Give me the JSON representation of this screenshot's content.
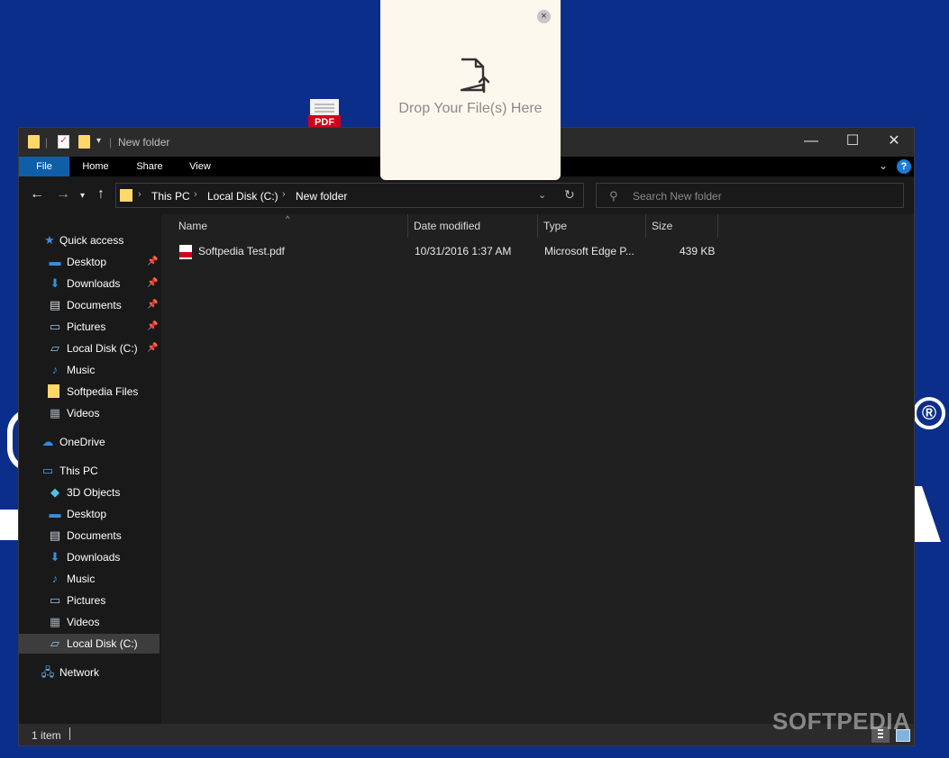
{
  "desktop": {
    "pdf_icon_label": "PDF",
    "registered_mark": "®"
  },
  "drop_panel": {
    "text": "Drop Your File(s) Here",
    "close_glyph": "×"
  },
  "window": {
    "title": "New folder",
    "dropdown_glyph": "▾",
    "controls": {
      "minimize": "—",
      "maximize": "☐",
      "close": "✕"
    }
  },
  "menu": {
    "file": "File",
    "home": "Home",
    "share": "Share",
    "view": "View",
    "help": "?"
  },
  "address": {
    "crumbs": [
      "This PC",
      "Local Disk (C:)",
      "New folder"
    ],
    "search_placeholder": "Search New folder"
  },
  "nav": {
    "quick_access": "Quick access",
    "quick_items": [
      {
        "label": "Desktop",
        "icon": "desktop-icon",
        "pinned": true
      },
      {
        "label": "Downloads",
        "icon": "downloads-icon",
        "pinned": true
      },
      {
        "label": "Documents",
        "icon": "documents-icon",
        "pinned": true
      },
      {
        "label": "Pictures",
        "icon": "pictures-icon",
        "pinned": true
      },
      {
        "label": "Local Disk (C:)",
        "icon": "local-disk-icon",
        "pinned": true
      },
      {
        "label": "Music",
        "icon": "music-icon",
        "pinned": false
      },
      {
        "label": "Softpedia Files",
        "icon": "folder-icon",
        "pinned": false
      },
      {
        "label": "Videos",
        "icon": "videos-icon",
        "pinned": false
      }
    ],
    "onedrive": "OneDrive",
    "this_pc": "This PC",
    "pc_items": [
      {
        "label": "3D Objects",
        "icon": "3d-objects-icon"
      },
      {
        "label": "Desktop",
        "icon": "desktop-icon"
      },
      {
        "label": "Documents",
        "icon": "documents-icon"
      },
      {
        "label": "Downloads",
        "icon": "downloads-icon"
      },
      {
        "label": "Music",
        "icon": "music-icon"
      },
      {
        "label": "Pictures",
        "icon": "pictures-icon"
      },
      {
        "label": "Videos",
        "icon": "videos-icon"
      },
      {
        "label": "Local Disk (C:)",
        "icon": "local-disk-icon",
        "selected": true
      }
    ],
    "network": "Network"
  },
  "columns": {
    "name": "Name",
    "date_modified": "Date modified",
    "type": "Type",
    "size": "Size"
  },
  "files": [
    {
      "name": "Softpedia Test.pdf",
      "date_modified": "10/31/2016 1:37 AM",
      "type": "Microsoft Edge P...",
      "size": "439 KB"
    }
  ],
  "status": {
    "item_count": "1 item"
  },
  "watermark": "SOFTPEDIA"
}
